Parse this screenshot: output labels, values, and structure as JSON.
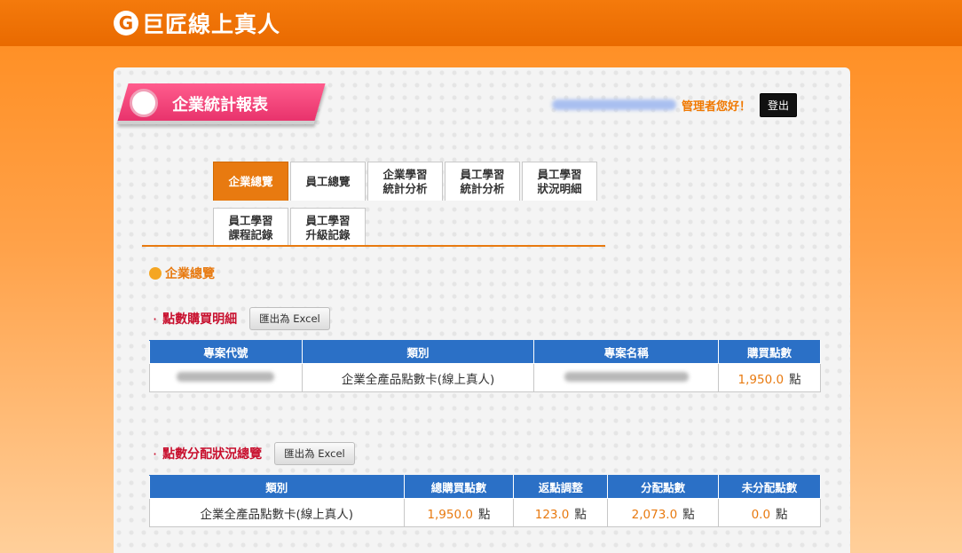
{
  "header": {
    "brand_logo": "G",
    "brand_name": "巨匠線上真人"
  },
  "page": {
    "title": "企業統計報表",
    "greeting": "管理者您好！",
    "logout_label": "登出"
  },
  "tabs": [
    {
      "label": "企業總覽",
      "active": true
    },
    {
      "label": "員工總覽",
      "active": false
    },
    {
      "label": "企業學習\n統計分析",
      "active": false
    },
    {
      "label": "員工學習\n統計分析",
      "active": false
    },
    {
      "label": "員工學習\n狀況明細",
      "active": false
    },
    {
      "label": "員工學習\n課程記錄",
      "active": false
    },
    {
      "label": "員工學習\n升級記錄",
      "active": false
    }
  ],
  "section": {
    "title": "企業總覽"
  },
  "purchase": {
    "bullet": "·",
    "title": "點數購買明細",
    "export_label": "匯出為 Excel",
    "columns": [
      "專案代號",
      "類別",
      "專案名稱",
      "購買點數"
    ],
    "rows": [
      {
        "category": "企業全產品點數卡(線上真人)",
        "points": "1,950.0",
        "unit": "點"
      }
    ]
  },
  "distribution": {
    "bullet": "·",
    "title": "點數分配狀況總覽",
    "export_label": "匯出為 Excel",
    "columns": [
      "類別",
      "總購買點數",
      "返點調整",
      "分配點數",
      "未分配點數"
    ],
    "rows": [
      {
        "category": "企業全產品點數卡(線上真人)",
        "total": "1,950.0",
        "rebate": "123.0",
        "allocated": "2,073.0",
        "unallocated": "0.0",
        "unit": "點"
      }
    ]
  },
  "colors": {
    "orange": "#e87a10",
    "header_blue": "#2b70c6",
    "pink": "#e8336c",
    "red": "#c8102e"
  }
}
